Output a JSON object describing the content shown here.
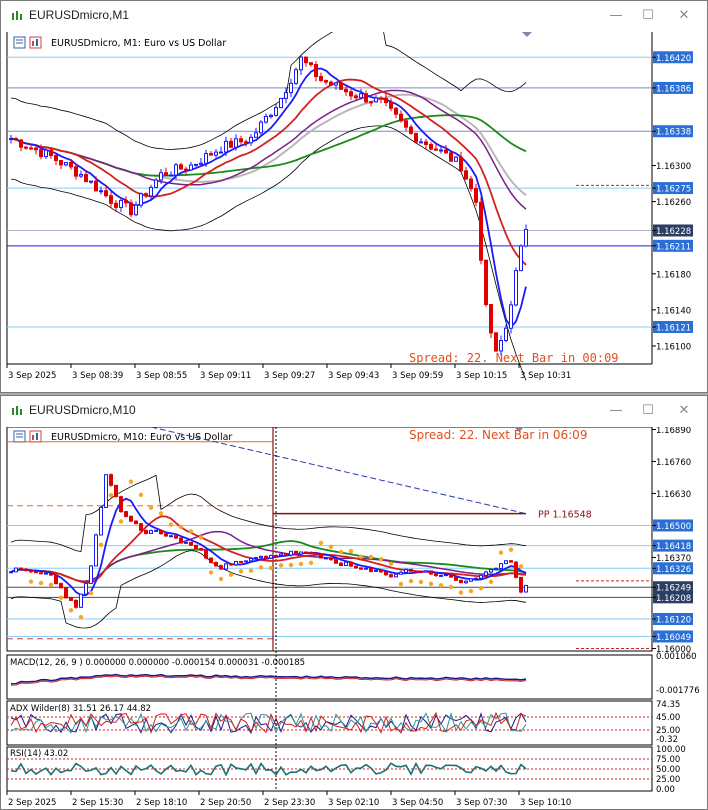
{
  "window1": {
    "title": "EURUSDmicro,M1",
    "chart_label": "EURUSDmicro, M1:  Euro vs US Dollar",
    "spread_text": "Spread: 22. Next Bar in 00:09",
    "price_labels": [
      "1.16420",
      "1.16386",
      "1.16338",
      "1.16300",
      "1.16275",
      "1.16260",
      "1.16228",
      "1.16211",
      "1.16180",
      "1.16140",
      "1.16121",
      "1.16100"
    ],
    "time_labels": [
      "3 Sep 2025",
      "3 Sep 08:39",
      "3 Sep 08:55",
      "3 Sep 09:11",
      "3 Sep 09:27",
      "3 Sep 09:43",
      "3 Sep 09:59",
      "3 Sep 10:15",
      "3 Sep 10:31"
    ],
    "minimize": "—",
    "maximize": "☐",
    "close": "✕"
  },
  "window2": {
    "title": "EURUSDmicro,M10",
    "chart_label": "EURUSDmicro, M10:  Euro vs US Dollar",
    "spread_text": "Spread: 22. Next Bar in 06:09",
    "pivot_label": "PP 1.16548",
    "price_labels": [
      "1.16890",
      "1.16760",
      "1.16630",
      "1.16500",
      "1.16418",
      "1.16370",
      "1.16326",
      "1.16249",
      "1.16208",
      "1.16120",
      "1.16049",
      "1.16000"
    ],
    "macd_label": "MACD(12, 26, 9 ) 0.000000 0.000000 -0.000154 0.000031 -0.000185",
    "macd_scale": [
      "0.001060",
      "-0.001776"
    ],
    "adx_label": "ADX Wilder(8) 31.51 26.17 44.82",
    "adx_scale": [
      "74.35",
      "45.00",
      "25.00",
      "-0.32"
    ],
    "rsi_label": "RSI(14) 43.02",
    "rsi_scale": [
      "100.00",
      "75.00",
      "50.00",
      "25.00",
      "0.00"
    ],
    "time_labels": [
      "2 Sep 2025",
      "2 Sep 15:30",
      "2 Sep 18:10",
      "2 Sep 20:50",
      "2 Sep 23:30",
      "3 Sep 02:10",
      "3 Sep 04:50",
      "3 Sep 07:30",
      "3 Sep 10:10"
    ],
    "minimize": "—",
    "maximize": "☐",
    "close": "✕"
  },
  "colors": {
    "price_line": "#87cefa",
    "blue_line": "#1a1aff",
    "candle_up": "#1a1aff",
    "candle_down": "#e00000",
    "spread_text": "#e0501e",
    "ma_green": "#1a8a1a",
    "ma_purple": "#7b1f8a",
    "ma_red": "#d42020",
    "sar": "#f5a623"
  },
  "icons": [
    "chart-window-icon",
    "properties-icon",
    "indicator-icon"
  ]
}
